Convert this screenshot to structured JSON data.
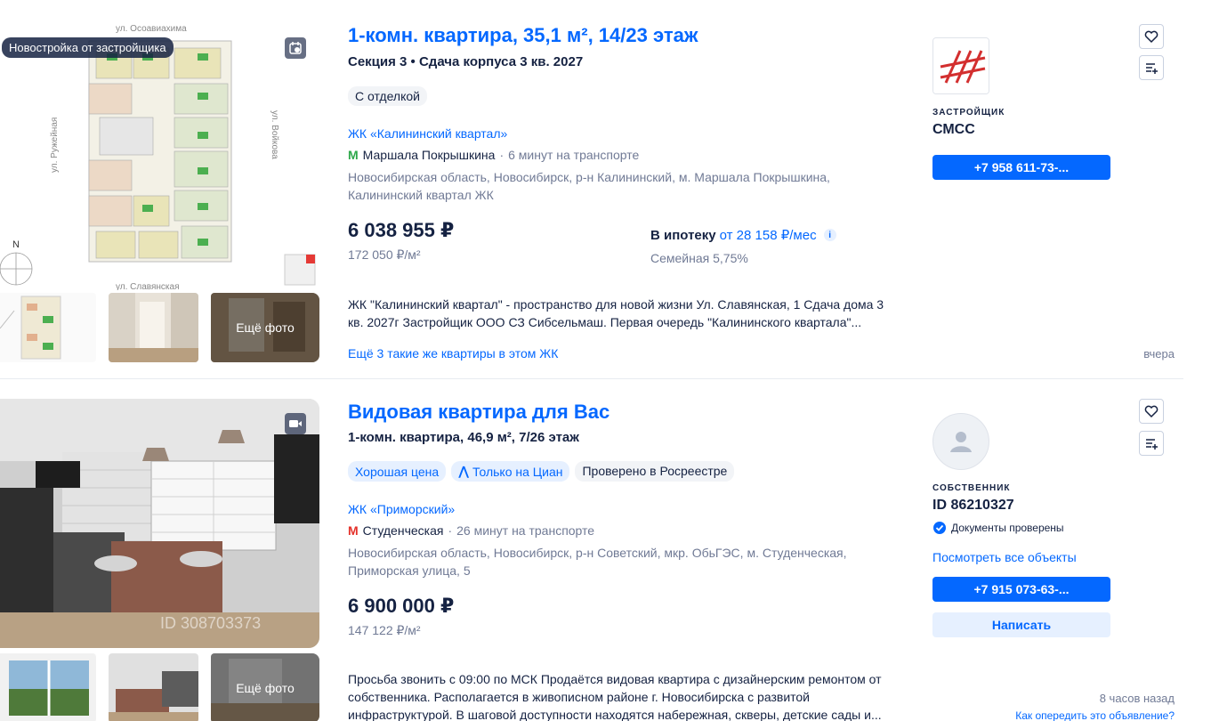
{
  "listings": [
    {
      "badge": "Новостройка от застройщика",
      "photo_icon": "history-icon",
      "more_photos_label": "Ещё фото",
      "title": "1-комн. квартира, 35,1 м², 14/23 этаж",
      "subtitle": "Секция 3 • Сдача корпуса 3 кв. 2027",
      "chips": [
        "С отделкой"
      ],
      "complex": "ЖК «Калининский квартал»",
      "metro_station": "Маршала Покрышкина",
      "metro_time": "6 минут на транспорте",
      "metro_color": "#2da84a",
      "address": "Новосибирская область, Новосибирск, р-н Калининский, м. Маршала Покрышкина, Калининский квартал ЖК",
      "price": "6 038 955 ₽",
      "price_per_m2": "172 050 ₽/м²",
      "mortgage_label": "В ипотеку",
      "mortgage_value": "от 28 158 ₽/мес",
      "mortgage_sub": "Семейная 5,75%",
      "description_line1": "ЖК \"Калининский квартал\" - пространство для новой жизни Ул. Славянская, 1 Сдача дома 3",
      "description_line2": "кв. 2027г Застройщик ООО СЗ Сибсельмаш. Первая очередь \"Калининского квартала\"...",
      "same_link": "Ещё 3 такие же квартиры в этом ЖК",
      "role": "ЗАСТРОЙЩИК",
      "seller": "СМСС",
      "phone": "+7 958 611-73-...",
      "date": "вчера",
      "plan_labels": {
        "street_top": "ул. Осоавиахима",
        "street_left": "ул. Ружейная",
        "street_right": "ул. Войкова",
        "street_bottom": "ул. Славянская",
        "north": "N"
      }
    },
    {
      "photo_icon": "video-icon",
      "more_photos_label": "Ещё фото",
      "title": "Видовая квартира для Вас",
      "subtitle": "1-комн. квартира, 46,9 м², 7/26 этаж",
      "chips": [
        "Хорошая цена",
        "Только на Циан",
        "Проверено в Росреестре"
      ],
      "complex": "ЖК «Приморский»",
      "metro_station": "Студенческая",
      "metro_time": "26 минут на транспорте",
      "metro_color": "#e4312a",
      "address": "Новосибирская область, Новосибирск, р-н Советский, мкр. ОбьГЭС, м. Студенческая, Приморская улица, 5",
      "price": "6 900 000 ₽",
      "price_per_m2": "147 122 ₽/м²",
      "description_line1": "Просьба звонить с 09:00 по МСК Продаётся видовая квартира с дизайнерским ремонтом от",
      "description_line2": "собственника. Располагается в живописном районе г. Новосибирска с развитой",
      "description_line3": "инфраструктурой. В шаговой доступности находятся набережная, скверы, детские сады и...",
      "role": "СОБСТВЕННИК",
      "seller": "ID 86210327",
      "verified": "Документы проверены",
      "all_objects": "Посмотреть все объекты",
      "phone": "+7 915 073-63-...",
      "write": "Написать",
      "date": "8 часов назад",
      "outrun": "Как опередить это объявление?",
      "watermark": "ID 308703373"
    }
  ]
}
